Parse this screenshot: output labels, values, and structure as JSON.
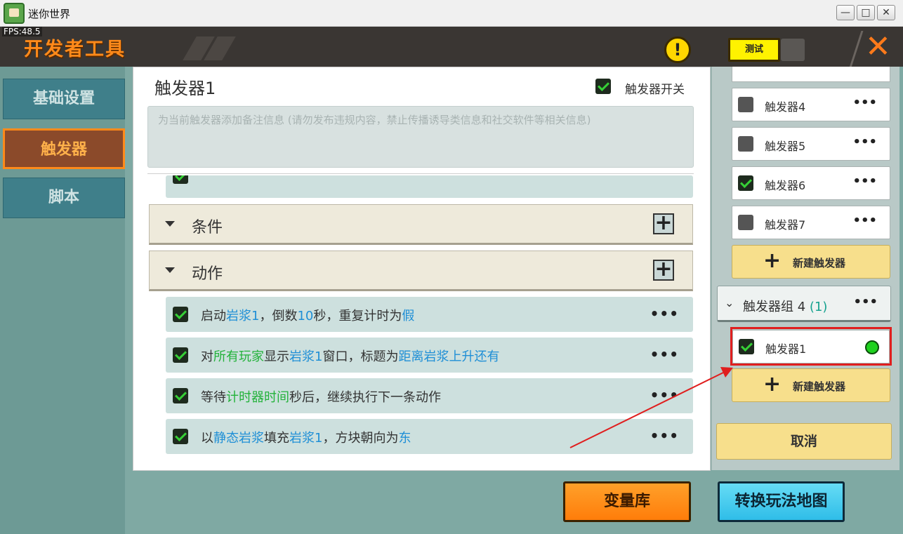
{
  "window": {
    "title": "迷你世界",
    "min_glyph": "—",
    "max_glyph": "□",
    "close_glyph": "✕"
  },
  "fps": "FPS:48.5",
  "header": {
    "title": "开发者工具",
    "warning_glyph": "!",
    "test_label": "测试",
    "close_glyph": "✕"
  },
  "nav": {
    "items": [
      {
        "label": "基础设置",
        "active": false
      },
      {
        "label": "触发器",
        "active": true
      },
      {
        "label": "脚本",
        "active": false
      }
    ]
  },
  "trigger": {
    "title": "触发器1",
    "switch_label": "触发器开关",
    "switch_on": true,
    "note_placeholder": "为当前触发器添加备注信息 (请勿发布违规内容，禁止传播诱导类信息和社交软件等相关信息)"
  },
  "sections": {
    "condition": {
      "label": "条件",
      "add_glyph": "+"
    },
    "action": {
      "label": "动作",
      "add_glyph": "+"
    }
  },
  "actions": [
    {
      "checked": true,
      "parts": [
        {
          "t": "启动",
          "c": ""
        },
        {
          "t": "岩浆1",
          "c": "blue"
        },
        {
          "t": "，倒数",
          "c": ""
        },
        {
          "t": "10",
          "c": "blue"
        },
        {
          "t": "秒，重复计时为",
          "c": ""
        },
        {
          "t": "假",
          "c": "blue"
        }
      ]
    },
    {
      "checked": true,
      "parts": [
        {
          "t": "对",
          "c": ""
        },
        {
          "t": "所有玩家",
          "c": "green"
        },
        {
          "t": "显示",
          "c": ""
        },
        {
          "t": "岩浆1",
          "c": "blue"
        },
        {
          "t": "窗口，标题为",
          "c": ""
        },
        {
          "t": "距离岩浆上升还有",
          "c": "blue"
        }
      ]
    },
    {
      "checked": true,
      "parts": [
        {
          "t": "等待",
          "c": ""
        },
        {
          "t": "计时器时间",
          "c": "green"
        },
        {
          "t": "秒后，继续执行下一条动作",
          "c": ""
        }
      ]
    },
    {
      "checked": true,
      "parts": [
        {
          "t": "以",
          "c": ""
        },
        {
          "t": "静态岩浆",
          "c": "blue"
        },
        {
          "t": "填充",
          "c": ""
        },
        {
          "t": "岩浆1",
          "c": "blue"
        },
        {
          "t": "，方块朝向为",
          "c": ""
        },
        {
          "t": "东",
          "c": "blue"
        }
      ]
    }
  ],
  "more_glyph": "•••",
  "right_panel": {
    "triggers": [
      {
        "label": "触发器4",
        "checked": false
      },
      {
        "label": "触发器5",
        "checked": false
      },
      {
        "label": "触发器6",
        "checked": true
      },
      {
        "label": "触发器7",
        "checked": false
      }
    ],
    "new_trigger_label": "新建触发器",
    "new_plus_glyph": "+",
    "group": {
      "chevron": "⌄",
      "label": "触发器组 4",
      "count": "(1)"
    },
    "group_trigger": {
      "label": "触发器1",
      "checked": true
    },
    "cancel_label": "取消"
  },
  "bottom": {
    "variables_label": "变量库",
    "convert_label": "转换玩法地图"
  },
  "colors": {
    "accent_orange": "#ff8a1a",
    "highlight_blue": "#1f8fd6",
    "highlight_green": "#23b23a",
    "annotation_red": "#e01e1e"
  }
}
